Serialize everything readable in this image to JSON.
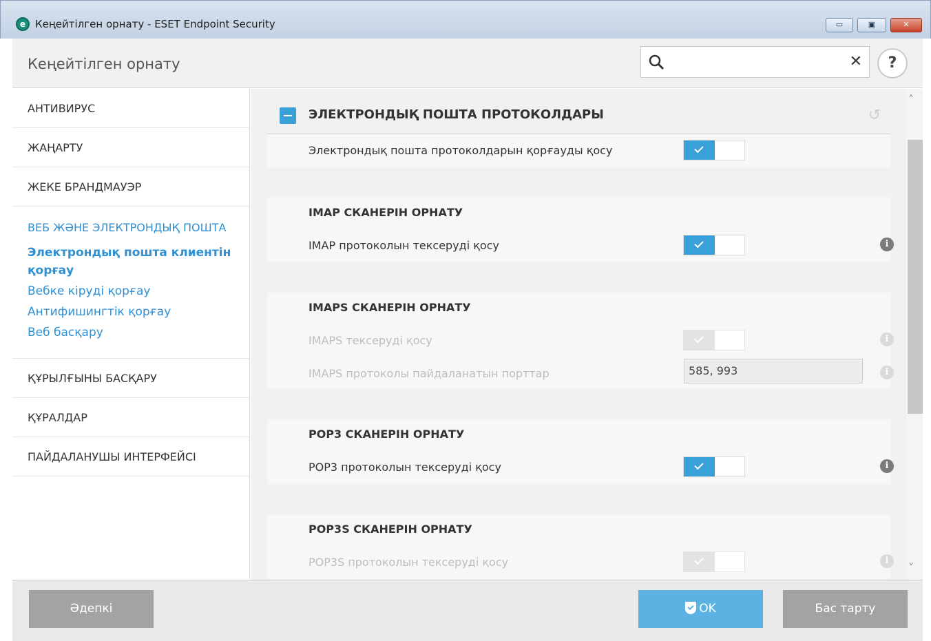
{
  "window": {
    "app_icon": "e",
    "title": "Кеңейтілген орнату - ESET Endpoint Security",
    "minimize": "▭",
    "maximize": "▣",
    "close": "✕"
  },
  "header": {
    "title": "Кеңейтілген орнату",
    "search_placeholder": "",
    "clear": "✕",
    "help": "?"
  },
  "sidebar": {
    "items_top": [
      {
        "label": "АНТИВИРУС"
      },
      {
        "label": "ЖАҢАРТУ"
      },
      {
        "label": "ЖЕКЕ БРАНДМАУЭР"
      }
    ],
    "group": {
      "title": "ВЕБ ЖӘНЕ ЭЛЕКТРОНДЫҚ ПОШТА",
      "subitems": [
        {
          "label": "Электрондық пошта клиентін қорғау",
          "active": true
        },
        {
          "label": "Вебке кіруді қорғау"
        },
        {
          "label": "Антифишингтік қорғау"
        },
        {
          "label": "Веб басқару"
        }
      ]
    },
    "items_bottom": [
      {
        "label": "ҚҰРЫЛҒЫНЫ БАСҚАРУ"
      },
      {
        "label": "ҚҰРАЛДАР"
      },
      {
        "label": "ПАЙДАЛАНУШЫ ИНТЕРФЕЙСІ"
      }
    ]
  },
  "main": {
    "section_title": "ЭЛЕКТРОНДЫҚ ПОШТА ПРОТОКОЛДАРЫ",
    "revert_icon": "↺",
    "enable_email_protection": {
      "label": "Электрондық пошта протоколдарын қорғауды қосу",
      "checked": true
    },
    "imap": {
      "title": "IMAP СКАНЕРІН ОРНАТУ",
      "enable": {
        "label": "IMAP протоколын тексеруді қосу",
        "checked": true
      }
    },
    "imaps": {
      "title": "IMAPS СКАНЕРІН ОРНАТУ",
      "enable": {
        "label": "IMAPS тексеруді қосу",
        "checked": true,
        "disabled": true
      },
      "ports": {
        "label": "IMAPS протоколы пайдаланатын порттар",
        "value": "585, 993",
        "disabled": true
      }
    },
    "pop3": {
      "title": "POP3 СКАНЕРІН ОРНАТУ",
      "enable": {
        "label": "POP3 протоколын тексеруді қосу",
        "checked": true
      }
    },
    "pop3s": {
      "title": "POP3S СКАНЕРІН ОРНАТУ",
      "enable": {
        "label": "POP3S протоколын тексеруді қосу",
        "checked": true,
        "disabled": true
      }
    },
    "info_glyph": "i"
  },
  "footer": {
    "default_label": "Әдепкі",
    "ok_label": "OK",
    "cancel_label": "Бас тарту"
  },
  "colors": {
    "accent": "#3aa0d8",
    "link": "#2f8fd1",
    "button_gray": "#a3a3a3",
    "ok_blue": "#5cb3e3"
  }
}
